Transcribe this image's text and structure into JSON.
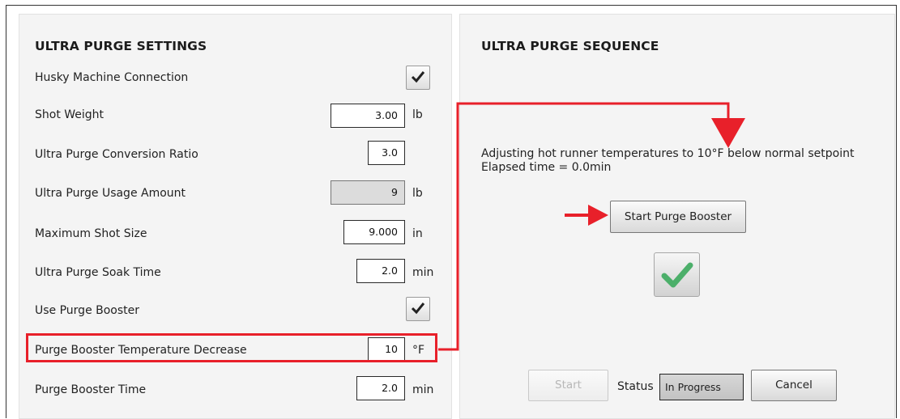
{
  "settings": {
    "title": "ULTRA PURGE SETTINGS",
    "rows": [
      {
        "label": "Husky Machine Connection",
        "type": "checkbox",
        "checked": true
      },
      {
        "label": "Shot Weight",
        "value": "3.00",
        "unit": "lb"
      },
      {
        "label": "Ultra Purge Conversion Ratio",
        "value": "3.0",
        "unit": ""
      },
      {
        "label": "Ultra Purge Usage Amount",
        "value": "9",
        "unit": "lb",
        "readonly": true
      },
      {
        "label": "Maximum Shot Size",
        "value": "9.000",
        "unit": "in"
      },
      {
        "label": "Ultra Purge Soak Time",
        "value": "2.0",
        "unit": "min"
      },
      {
        "label": "Use Purge Booster",
        "type": "checkbox",
        "checked": true
      },
      {
        "label": "Purge Booster Temperature Decrease",
        "value": "10",
        "unit": "°F",
        "highlighted": true
      },
      {
        "label": "Purge Booster Time",
        "value": "2.0",
        "unit": "min"
      }
    ]
  },
  "sequence": {
    "title": "ULTRA PURGE SEQUENCE",
    "message_line1": "Adjusting hot runner temperatures to 10°F below normal setpoint",
    "message_line2": "Elapsed time = 0.0min",
    "booster_button": "Start Purge Booster",
    "complete_icon": "green-check-icon",
    "start_button": "Start",
    "start_enabled": false,
    "status_label": "Status",
    "status_value": "In Progress",
    "cancel_button": "Cancel"
  },
  "colors": {
    "highlight": "#e8202a",
    "check_green": "#4caf6a"
  }
}
